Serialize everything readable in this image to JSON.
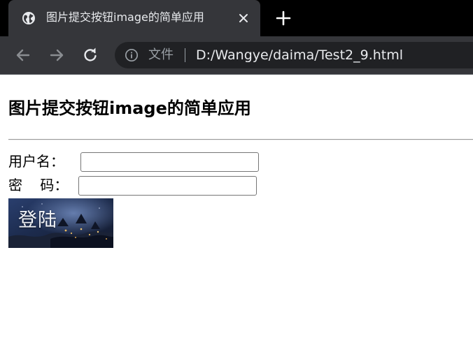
{
  "browser": {
    "tab": {
      "title": "图片提交按钮image的简单应用",
      "favicon": "globe-icon",
      "close_icon": "close-icon"
    },
    "new_tab_icon": "plus-icon",
    "toolbar": {
      "back_icon": "arrow-left-icon",
      "forward_icon": "arrow-right-icon",
      "reload_icon": "reload-icon",
      "info_icon": "info-icon",
      "security_chip": "文件",
      "url": "D:/Wangye/daima/Test2_9.html"
    },
    "colors": {
      "tabstrip": "#000000",
      "toolbar": "#35363a",
      "omnibox": "#202124"
    }
  },
  "page": {
    "heading": "图片提交按钮image的简单应用",
    "form": {
      "username_label": "用户名：",
      "username_value": "",
      "password_label": "密    码：",
      "password_value": "",
      "submit_image_text": "登陆"
    }
  }
}
